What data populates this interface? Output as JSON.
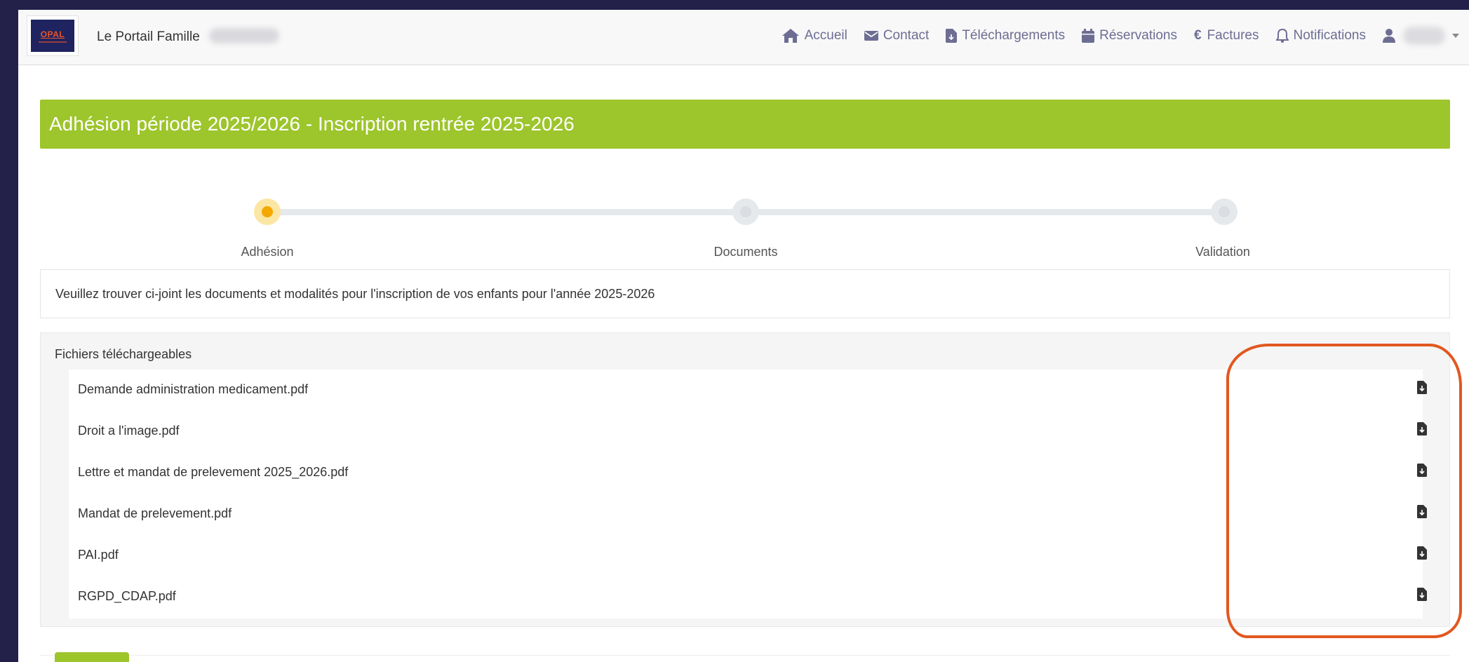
{
  "header": {
    "logo_text": "OPAL",
    "brand": "Le Portail Famille",
    "nav": [
      {
        "label": "Accueil",
        "icon": "home-icon"
      },
      {
        "label": "Contact",
        "icon": "envelope-icon"
      },
      {
        "label": "Téléchargements",
        "icon": "file-download-icon"
      },
      {
        "label": "Réservations",
        "icon": "calendar-icon"
      },
      {
        "label": "Factures",
        "icon": "euro-icon"
      },
      {
        "label": "Notifications",
        "icon": "bell-icon"
      }
    ]
  },
  "banner": {
    "title": "Adhésion période 2025/2026 - Inscription rentrée 2025-2026"
  },
  "stepper": {
    "steps": [
      {
        "label": "Adhésion",
        "active": true
      },
      {
        "label": "Documents",
        "active": false
      },
      {
        "label": "Validation",
        "active": false
      }
    ]
  },
  "info": {
    "text": "Veuillez trouver ci-joint les documents et modalités pour l'inscription de vos enfants pour l'année 2025-2026"
  },
  "files": {
    "title": "Fichiers téléchargeables",
    "items": [
      {
        "name": "Demande administration medicament.pdf"
      },
      {
        "name": "Droit a l'image.pdf"
      },
      {
        "name": "Lettre et mandat de prelevement 2025_2026.pdf"
      },
      {
        "name": "Mandat de prelevement.pdf"
      },
      {
        "name": "PAI.pdf"
      },
      {
        "name": "RGPD_CDAP.pdf"
      }
    ]
  },
  "colors": {
    "accent_green": "#9dc52c",
    "nav_text": "#6d6d94",
    "annotation": "#e2571f",
    "step_active": "#f5c518"
  }
}
